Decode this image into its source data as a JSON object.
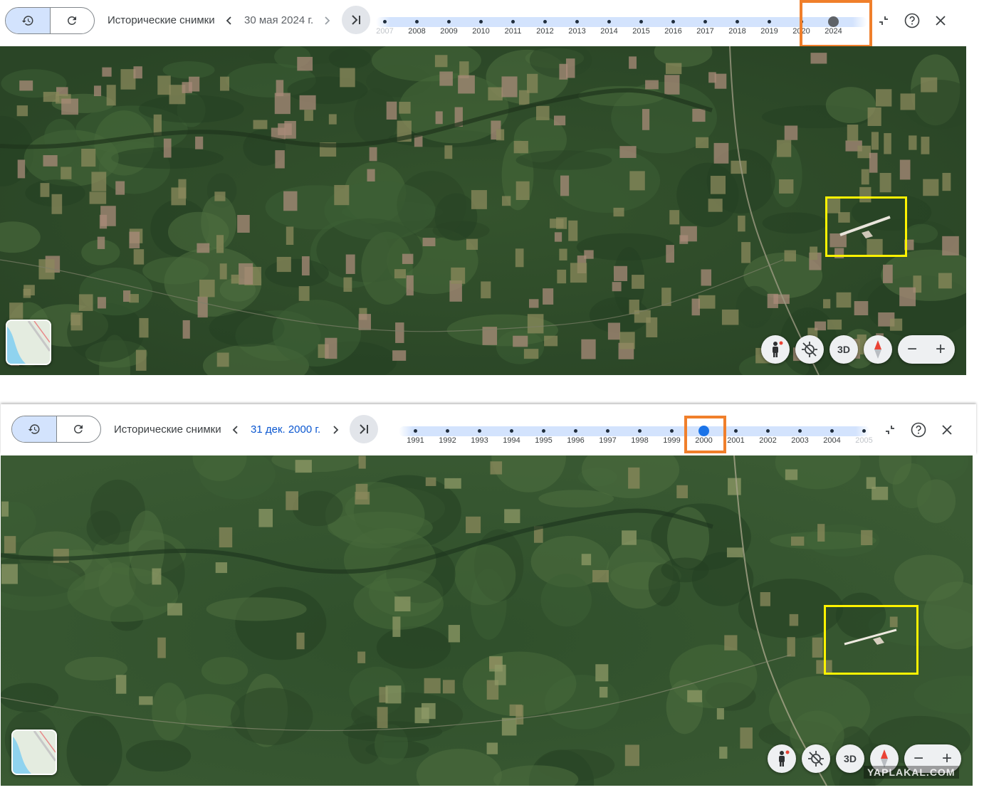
{
  "top": {
    "title": "Исторические снимки",
    "date": "30 мая 2024 г.",
    "years": [
      {
        "label": "2007",
        "faded": true
      },
      {
        "label": "2008"
      },
      {
        "label": "2009"
      },
      {
        "label": "2010"
      },
      {
        "label": "2011"
      },
      {
        "label": "2012"
      },
      {
        "label": "2013"
      },
      {
        "label": "2014"
      },
      {
        "label": "2015"
      },
      {
        "label": "2016"
      },
      {
        "label": "2017"
      },
      {
        "label": "2018"
      },
      {
        "label": "2019"
      },
      {
        "label": "2020"
      },
      {
        "label": "2024",
        "selected": true
      }
    ],
    "three_d_label": "3D",
    "minus_label": "−",
    "plus_label": "+"
  },
  "bottom": {
    "title": "Исторические снимки",
    "date": "31 дек. 2000 г.",
    "years": [
      {
        "label": "1991"
      },
      {
        "label": "1992"
      },
      {
        "label": "1993"
      },
      {
        "label": "1994"
      },
      {
        "label": "1995"
      },
      {
        "label": "1996"
      },
      {
        "label": "1997"
      },
      {
        "label": "1998"
      },
      {
        "label": "1999"
      },
      {
        "label": "2000",
        "selected": true
      },
      {
        "label": "2001"
      },
      {
        "label": "2002"
      },
      {
        "label": "2003"
      },
      {
        "label": "2004"
      },
      {
        "label": "2005",
        "faded": true
      }
    ],
    "three_d_label": "3D",
    "minus_label": "−",
    "plus_label": "+",
    "watermark": "YAPLAKAL.COM"
  },
  "colors": {
    "highlight_orange": "#f07f2b",
    "selection_yellow": "#fff200",
    "selected_dot_blue": "#1a73e8",
    "selected_dot_grey": "#5f6368",
    "date_blue": "#0b57d0",
    "timeline_track": "#d3e3fd",
    "forest_dark": "#2b4a28",
    "forest_mid": "#355a30",
    "clearing": "#8b8a5c",
    "cut_pink": "#a98b79"
  },
  "icons": [
    "history-icon",
    "refresh-icon",
    "chevron-left-icon",
    "chevron-right-icon",
    "skip-to-latest-icon",
    "collapse-icon",
    "help-icon",
    "close-icon",
    "pegman-icon",
    "location-icon",
    "compass-icon"
  ]
}
